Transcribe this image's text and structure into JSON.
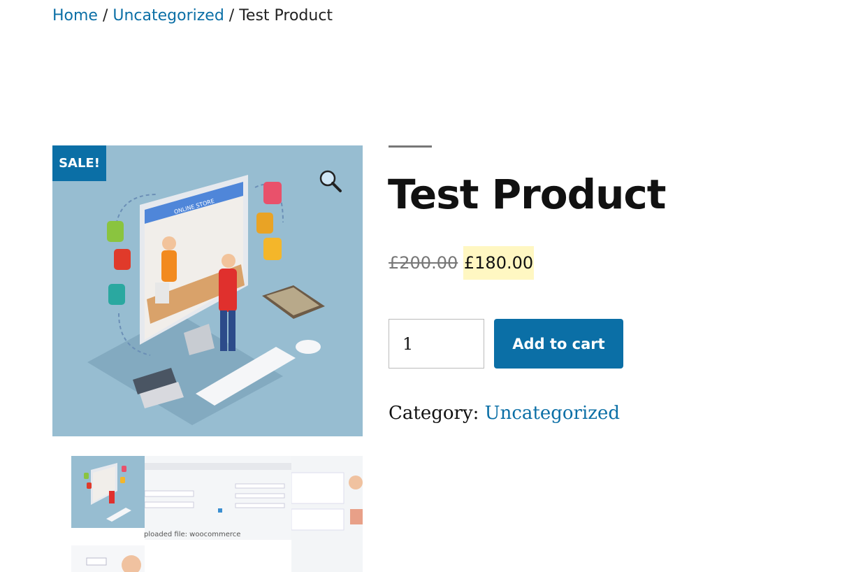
{
  "breadcrumb": {
    "home": "Home",
    "category": "Uncategorized",
    "current": "Test Product",
    "separator": " / "
  },
  "gallery": {
    "sale_badge": "SALE!",
    "zoom_icon": "magnifier-icon",
    "screen_sign": "ONLINE STORE",
    "thumbnail_caption": "ploaded file: woocommerce"
  },
  "product": {
    "title": "Test Product",
    "regular_price": "£200.00",
    "sale_price": "£180.00",
    "quantity": "1",
    "add_to_cart_label": "Add to cart",
    "category_label": "Category:",
    "category_value": "Uncategorized"
  },
  "colors": {
    "accent": "#0b6fa6",
    "image_background": "#97bdd1",
    "sale_highlight": "#fff7c2"
  }
}
